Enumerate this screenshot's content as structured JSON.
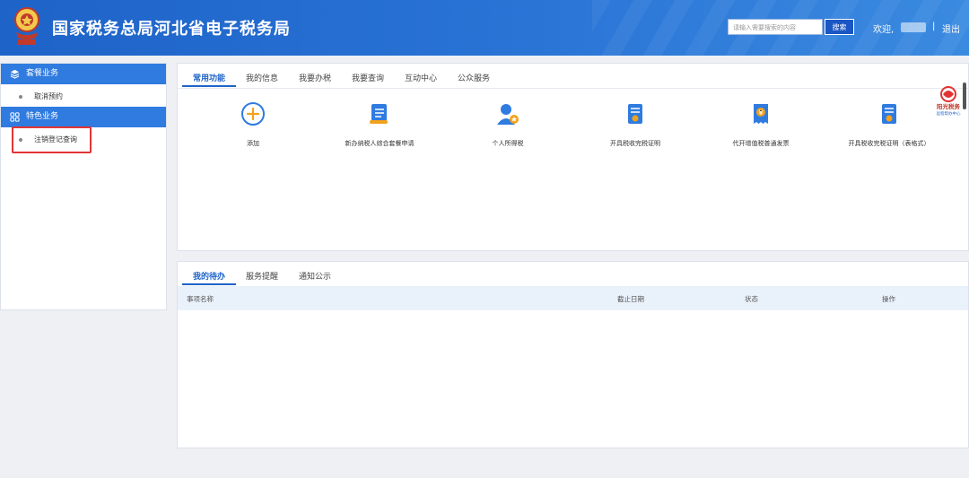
{
  "header": {
    "title": "国家税务总局河北省电子税务局",
    "search_placeholder": "请输入需要搜索的内容",
    "search_button": "搜索",
    "welcome": "欢迎,",
    "separator": "|",
    "logout": "退出",
    "colors": {
      "primary": "#1e63c8",
      "light": "#3a8ae0"
    }
  },
  "sidebar": {
    "sections": [
      {
        "label": "套餐业务",
        "icon": "stack-icon",
        "items": [
          "取消预约"
        ]
      },
      {
        "label": "特色业务",
        "icon": "grid-icon",
        "items": [
          "注销登记查询"
        ]
      }
    ]
  },
  "main": {
    "tabs": [
      "常用功能",
      "我的信息",
      "我要办税",
      "我要查询",
      "互动中心",
      "公众服务"
    ],
    "functions": [
      {
        "label": "添加",
        "icon": "plus-circle-icon"
      },
      {
        "label": "新办纳税人综合套餐申请",
        "icon": "document-scroll-icon"
      },
      {
        "label": "个人所得税",
        "icon": "person-badge-icon"
      },
      {
        "label": "开具税收完税证明",
        "icon": "certificate-icon"
      },
      {
        "label": "代开增值税普通发票",
        "icon": "invoice-icon"
      },
      {
        "label": "开具税收完税证明（表格式）",
        "icon": "certificate-form-icon"
      }
    ]
  },
  "todo": {
    "tabs": [
      "我的待办",
      "服务提醒",
      "通知公示"
    ],
    "columns": [
      "事项名称",
      "截止日期",
      "状态",
      "操作"
    ]
  },
  "brand": {
    "icon": "brand-logo-icon",
    "line1": "阳光税务",
    "line2": "远程帮办中心"
  }
}
